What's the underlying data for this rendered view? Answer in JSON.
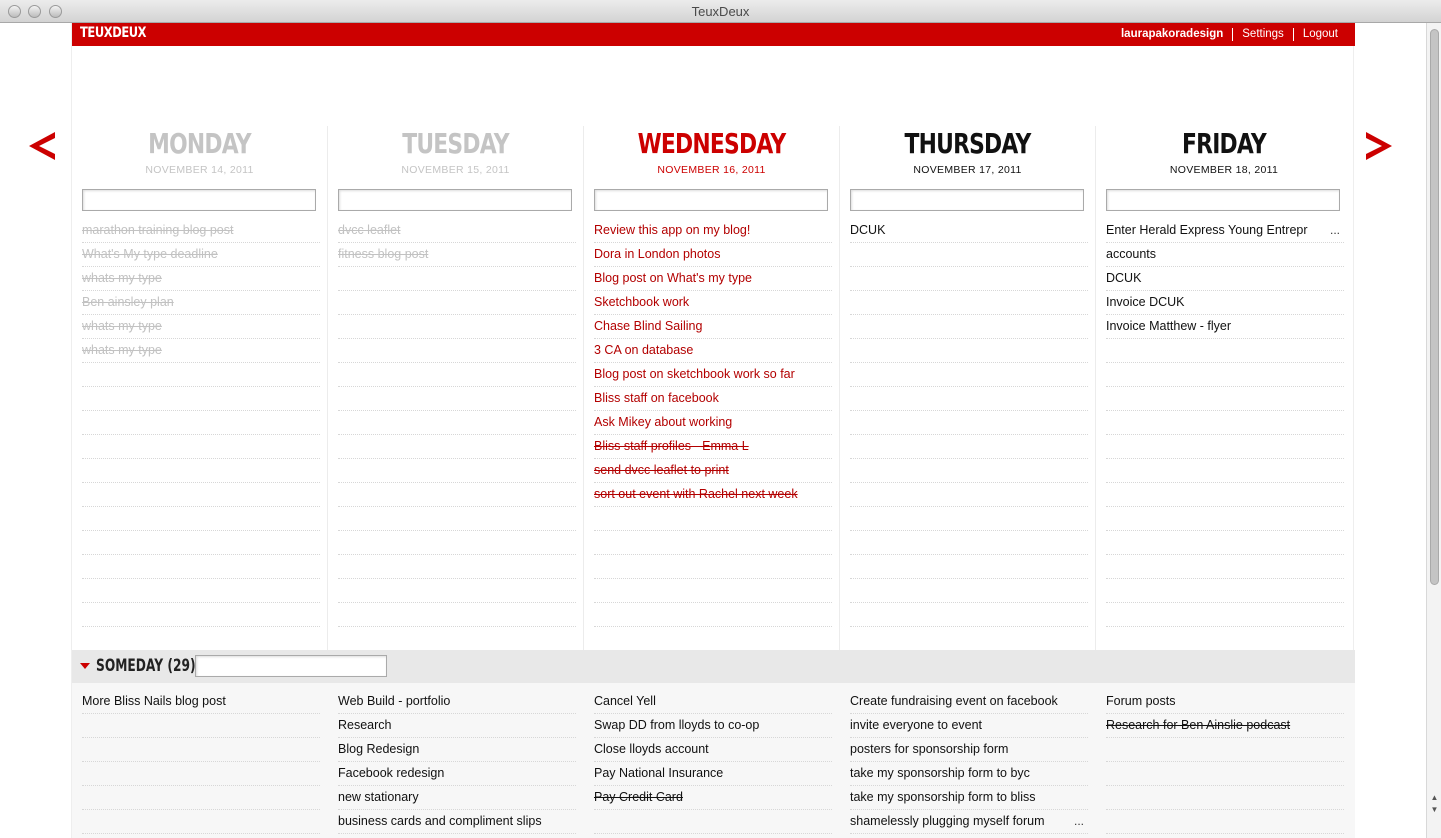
{
  "window": {
    "title": "TeuxDeux"
  },
  "app": {
    "logo": "TEUXDEUX",
    "user": "laurapakoradesign",
    "settings": "Settings",
    "logout": "Logout"
  },
  "days": [
    {
      "name": "MONDAY",
      "date": "NOVEMBER 14, 2011",
      "state": "past",
      "items": [
        "marathon training blog post",
        "What's My type deadline",
        "whats my type",
        "Ben ainsley plan",
        "whats my type",
        "whats my type"
      ]
    },
    {
      "name": "TUESDAY",
      "date": "NOVEMBER 15, 2011",
      "state": "past",
      "items": [
        "dvcc leaflet",
        "fitness blog post"
      ]
    },
    {
      "name": "WEDNESDAY",
      "date": "NOVEMBER 16, 2011",
      "state": "today",
      "items": [
        "Review this app on my blog!",
        "Dora in London photos",
        "Blog post on What's my type",
        "Sketchbook work",
        "Chase Blind Sailing",
        "3 CA on database",
        "Blog post on sketchbook work so far",
        "Bliss staff on facebook",
        "Ask Mikey about working",
        "Bliss staff profiles - Emma L",
        "send dvcc leaflet to print",
        "sort out event with Rachel next week"
      ],
      "done": [
        9,
        10,
        11
      ]
    },
    {
      "name": "THURSDAY",
      "date": "NOVEMBER 17, 2011",
      "state": "future",
      "items": [
        "DCUK"
      ]
    },
    {
      "name": "FRIDAY",
      "date": "NOVEMBER 18, 2011",
      "state": "future",
      "items": [
        "Enter Herald Express Young Entrepr",
        "accounts",
        "DCUK",
        "Invoice DCUK",
        "Invoice Matthew - flyer"
      ],
      "more_on": 0
    }
  ],
  "someday": {
    "label": "SOMEDAY (29)",
    "columns": [
      {
        "items": [
          "More Bliss Nails blog post"
        ]
      },
      {
        "items": [
          "Web Build - portfolio",
          "Research",
          "Blog Redesign",
          "Facebook redesign",
          "new stationary",
          "business cards and compliment slips"
        ]
      },
      {
        "items": [
          "Cancel Yell",
          "Swap DD from lloyds to co-op",
          "Close lloyds account",
          "Pay National Insurance",
          "Pay Credit Card"
        ],
        "done": [
          4
        ]
      },
      {
        "items": [
          "Create fundraising event on facebook",
          "invite everyone to event",
          "posters for sponsorship form",
          "take my sponsorship form to byc",
          "take my sponsorship form to bliss",
          "shamelessly plugging myself forum"
        ],
        "more_on": 5
      },
      {
        "items": [
          "Forum posts",
          "Research for Ben Ainslie podcast"
        ],
        "done": [
          1
        ]
      }
    ]
  },
  "more_glyph": "...",
  "colors": {
    "brand_red": "#cc0000",
    "today_text": "#b30000",
    "past_text": "#c2c2c2"
  },
  "icons": {
    "prev": "chevron-left-icon",
    "next": "chevron-right-icon",
    "collapse": "triangle-down-icon"
  }
}
